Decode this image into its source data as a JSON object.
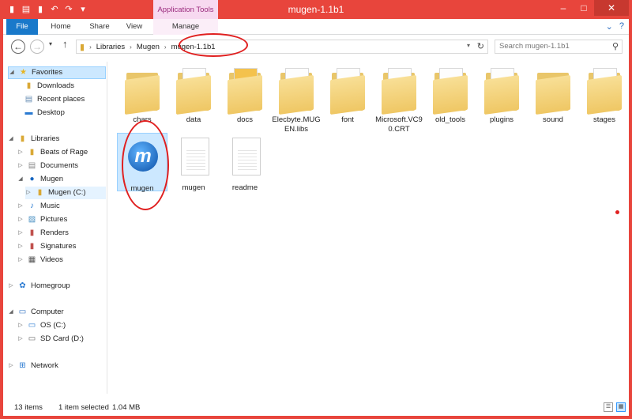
{
  "window": {
    "title": "mugen-1.1b1",
    "app_tools": "Application Tools"
  },
  "ribbon": {
    "tabs": [
      "File",
      "Home",
      "Share",
      "View",
      "Manage"
    ]
  },
  "nav": {
    "path": [
      "Libraries",
      "Mugen",
      "mugen-1.1b1"
    ],
    "search_placeholder": "Search mugen-1.1b1"
  },
  "sidebar": {
    "favorites": {
      "label": "Favorites",
      "items": [
        "Downloads",
        "Recent places",
        "Desktop"
      ]
    },
    "libraries": {
      "label": "Libraries",
      "items": [
        "Beats of Rage",
        "Documents",
        "Mugen",
        "Mugen (C:)",
        "Music",
        "Pictures",
        "Renders",
        "Signatures",
        "Videos"
      ]
    },
    "homegroup": "Homegroup",
    "computer": {
      "label": "Computer",
      "items": [
        "OS (C:)",
        "SD Card (D:)"
      ]
    },
    "network": "Network"
  },
  "files": {
    "row1": [
      "chars",
      "data",
      "docs",
      "Elecbyte.MUGEN.libs",
      "font",
      "Microsoft.VC90.CRT",
      "old_tools",
      "plugins",
      "sound",
      "stages"
    ],
    "row2": [
      "mugen",
      "mugen",
      "readme"
    ]
  },
  "status": {
    "count": "13 items",
    "selection": "1 item selected",
    "size": "1.04 MB"
  },
  "colors": {
    "accent": "#1979ca",
    "frame": "#e8453c",
    "selection": "#cce8ff",
    "annotation": "#e02020"
  }
}
